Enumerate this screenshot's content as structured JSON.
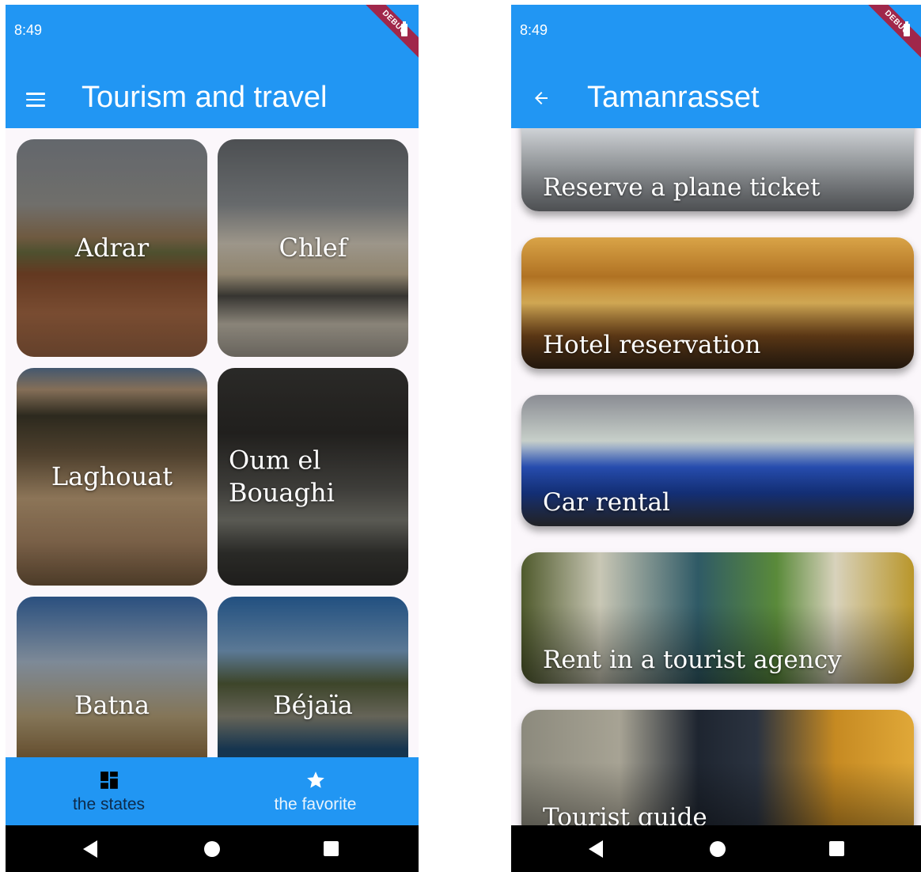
{
  "left_screen": {
    "status_time": "8:49",
    "debug_label": "DEBUG",
    "title": "Tourism and travel",
    "tiles": [
      {
        "label": "Adrar"
      },
      {
        "label": "Chlef"
      },
      {
        "label": "Laghouat"
      },
      {
        "label": "Oum el Bouaghi"
      },
      {
        "label": "Batna"
      },
      {
        "label": "Béjaïa"
      }
    ],
    "bottom_nav": {
      "states_label": "the states",
      "favorite_label": "the favorite"
    }
  },
  "right_screen": {
    "status_time": "8:49",
    "debug_label": "DEBUG",
    "title": "Tamanrasset",
    "cards": [
      {
        "label": "Reserve a plane ticket"
      },
      {
        "label": "Hotel reservation"
      },
      {
        "label": "Car rental"
      },
      {
        "label": "Rent in a tourist agency"
      },
      {
        "label": "Tourist guide"
      }
    ]
  },
  "colors": {
    "primary": "#2196f3",
    "debug_banner": "#a0274a",
    "background": "#fbf7fb"
  }
}
